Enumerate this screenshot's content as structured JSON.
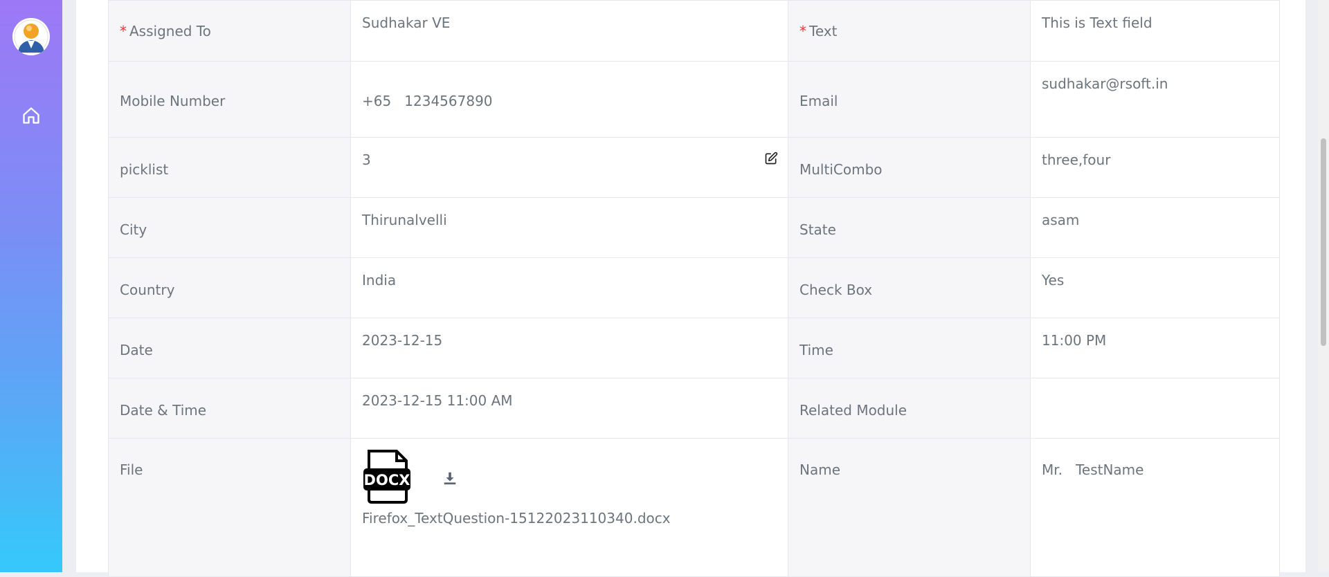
{
  "sidebar": {
    "avatar_icon": "user-avatar-icon",
    "home_icon": "home-icon"
  },
  "fields": {
    "assigned_to": {
      "label": "Assigned To",
      "value": "Sudhakar VE",
      "required": "*"
    },
    "text": {
      "label": "Text",
      "value": "This is Text field",
      "required": "*"
    },
    "mobile": {
      "label": "Mobile Number",
      "value": "+65   1234567890"
    },
    "email": {
      "label": "Email",
      "value": "sudhakar@rsoft.in"
    },
    "picklist": {
      "label": "picklist",
      "value": "3"
    },
    "multicombo": {
      "label": "MultiCombo",
      "value": "three,four"
    },
    "city": {
      "label": "City",
      "value": "Thirunalvelli"
    },
    "state": {
      "label": "State",
      "value": "asam"
    },
    "country": {
      "label": "Country",
      "value": "India"
    },
    "checkbox": {
      "label": "Check Box",
      "value": "Yes"
    },
    "date": {
      "label": "Date",
      "value": "2023-12-15"
    },
    "time": {
      "label": "Time",
      "value": "11:00 PM"
    },
    "datetime": {
      "label": "Date & Time",
      "value": "2023-12-15 11:00 AM"
    },
    "related_module": {
      "label": "Related Module",
      "value": ""
    },
    "file": {
      "label": "File",
      "filename": "Firefox_TextQuestion-15122023110340.docx",
      "badge": "DOCX"
    },
    "name": {
      "label": "Name",
      "value": "Mr.   TestName"
    }
  },
  "colors": {
    "required": "#e53935",
    "label_bg": "#f6f6f8",
    "text": "#6c757d"
  }
}
